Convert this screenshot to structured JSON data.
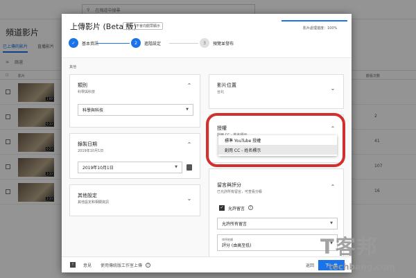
{
  "background": {
    "search_placeholder": "在頻道中搜尋",
    "page_title": "頻道影片",
    "tabs": [
      "已上傳的影片",
      "直播影片"
    ],
    "filter_label": "篩選",
    "column_video": "影片",
    "column_views": "觀看次數",
    "rows": [
      {
        "duration": "1:00",
        "views": ""
      },
      {
        "duration": "0:33",
        "views": "2"
      },
      {
        "duration": "0:23",
        "views": "41"
      },
      {
        "duration": "3:33",
        "views": "107"
      },
      {
        "duration": "3:33",
        "views": "16"
      }
    ]
  },
  "modal": {
    "title": "上傳影片 (Beta 版)",
    "badge": "草稿・不會向觀眾顯示",
    "progress_label": "影片處理進度：100%",
    "progress_value": 100,
    "steps": [
      {
        "number": "✓",
        "label": "基本資訊",
        "state": "done"
      },
      {
        "number": "2",
        "label": "進階設定",
        "state": "current"
      },
      {
        "number": "3",
        "label": "預覽並發布",
        "state": "pending"
      }
    ],
    "section_label": "其他",
    "category": {
      "title": "類別",
      "subtitle": "科學與科技",
      "select_value": "科學與科技"
    },
    "recording_date": {
      "title": "錄製日期",
      "subtitle": "2019年10月1日",
      "select_value": "2019年10月1日"
    },
    "other_settings": {
      "title": "其他設定",
      "subtitle": "其他設定和相關資訊"
    },
    "video_location": {
      "title": "影片位置",
      "subtitle": "台北"
    },
    "license": {
      "title": "授權",
      "subtitle": "創用 CC - 姓名標示",
      "options": [
        "標準 YouTube 授權",
        "創用 CC - 姓名標示"
      ],
      "selected_index": 1
    },
    "comments": {
      "title": "留言與評分",
      "subtitle": "已允許所有留言，可查看分級",
      "allow_comments_label": "允許留言",
      "allow_comments_checked": true,
      "comment_mode": "允許所有留言",
      "sort_label": "排序依據",
      "sort_value": "評分 (由高至低)"
    },
    "footer": {
      "feedback": "意見",
      "legacy_link": "使用傳統版工作室上傳",
      "back": "返回",
      "next": "下一步"
    }
  },
  "watermark": {
    "main": "T客邦",
    "sub": "techbang.com"
  },
  "colors": {
    "accent": "#1a73e8",
    "highlight_ring": "#d0312d"
  }
}
